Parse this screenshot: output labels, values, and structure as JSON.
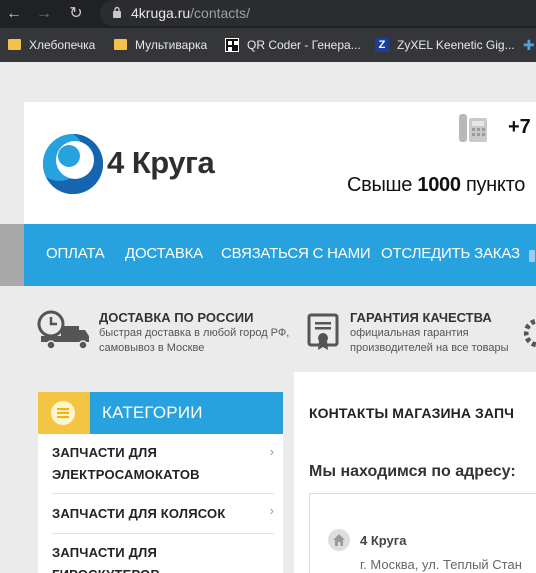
{
  "browser": {
    "url_host": "4kruga.ru",
    "url_path": "/contacts/",
    "bookmarks": [
      {
        "label": "Хлебопечка",
        "icon": "folder-icon"
      },
      {
        "label": "Мультиварка",
        "icon": "folder-icon"
      },
      {
        "label": "QR Coder - Генера...",
        "icon": "qr-icon"
      },
      {
        "label": "ZyXEL Keenetic Gig...",
        "icon": "zyxel-icon"
      }
    ]
  },
  "header": {
    "logo_text": "4 Круга",
    "phone": "+7",
    "tagline_prefix": "Свыше",
    "tagline_bold": "1000",
    "tagline_suffix": "пункто"
  },
  "nav": {
    "items": [
      "ОПЛАТА",
      "ДОСТАВКА",
      "СВЯЗАТЬСЯ С НАМИ",
      "ОТСЛЕДИТЬ ЗАКАЗ"
    ]
  },
  "features": [
    {
      "title": "ДОСТАВКА ПО РОССИИ",
      "line1": "быстрая доставка в любой город РФ,",
      "line2": "самовывоз в Москве",
      "icon": "truck-clock-icon"
    },
    {
      "title": "ГАРАНТИЯ КАЧЕСТВА",
      "line1": "официальная гарантия",
      "line2": "производителей на все товары",
      "icon": "certificate-icon"
    }
  ],
  "sidebar": {
    "title": "КАТЕГОРИИ",
    "items": [
      {
        "line1": "ЗАПЧАСТИ ДЛЯ",
        "line2": "ЭЛЕКТРОСАМОКАТОВ"
      },
      {
        "line1": "ЗАПЧАСТИ ДЛЯ КОЛЯСОК",
        "line2": ""
      },
      {
        "line1": "ЗАПЧАСТИ ДЛЯ",
        "line2": "ГИРОСКУТЕРОВ"
      }
    ]
  },
  "main": {
    "title": "КОНТАКТЫ МАГАЗИНА ЗАПЧ",
    "subtitle": "Мы находимся по адресу:",
    "store_name": "4 Круга",
    "address": "г. Москва, ул. Теплый Стан"
  },
  "colors": {
    "accent_blue": "#27a2de",
    "accent_yellow": "#f4c542",
    "logo_dark": "#2e2e2e"
  }
}
